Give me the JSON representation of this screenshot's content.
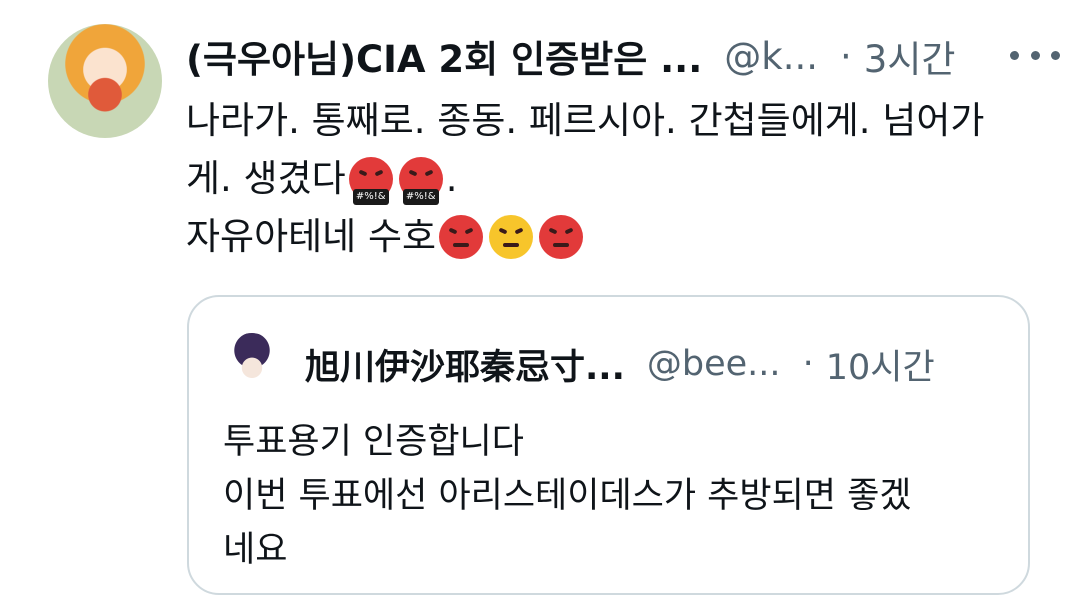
{
  "tweet": {
    "display_name": "(극우아님)CIA 2회 인증받은 ...",
    "handle": "@k...",
    "separator": "·",
    "time": "3시간",
    "text_line1": "나라가. 통째로. 종동. 페르시아. 간첩들에게. 넘어가",
    "text_line2_prefix": "게. 생겼다",
    "text_line2_suffix": ".",
    "text_line3_prefix": "자유아테네 수호",
    "emoji_symbol_text": "#%!&",
    "icons": [
      "more-horizontal-icon",
      "face-with-symbols-on-mouth-emoji",
      "angry-face-emoji",
      "confounded-face-emoji"
    ]
  },
  "quoted_tweet": {
    "display_name": "旭川伊沙耶秦忌寸...",
    "handle": "@bee...",
    "separator": "·",
    "time": "10시간",
    "text_line1": "투표용기 인증합니다",
    "text_line2": "이번 투표에선 아리스테이데스가 추방되면 좋겠",
    "text_line3": "네요"
  },
  "colors": {
    "text": "#0f1419",
    "secondary": "#536471",
    "border": "#cfd9de",
    "angry_red": "#e23a3a",
    "confounded_yellow": "#f7c52b"
  }
}
